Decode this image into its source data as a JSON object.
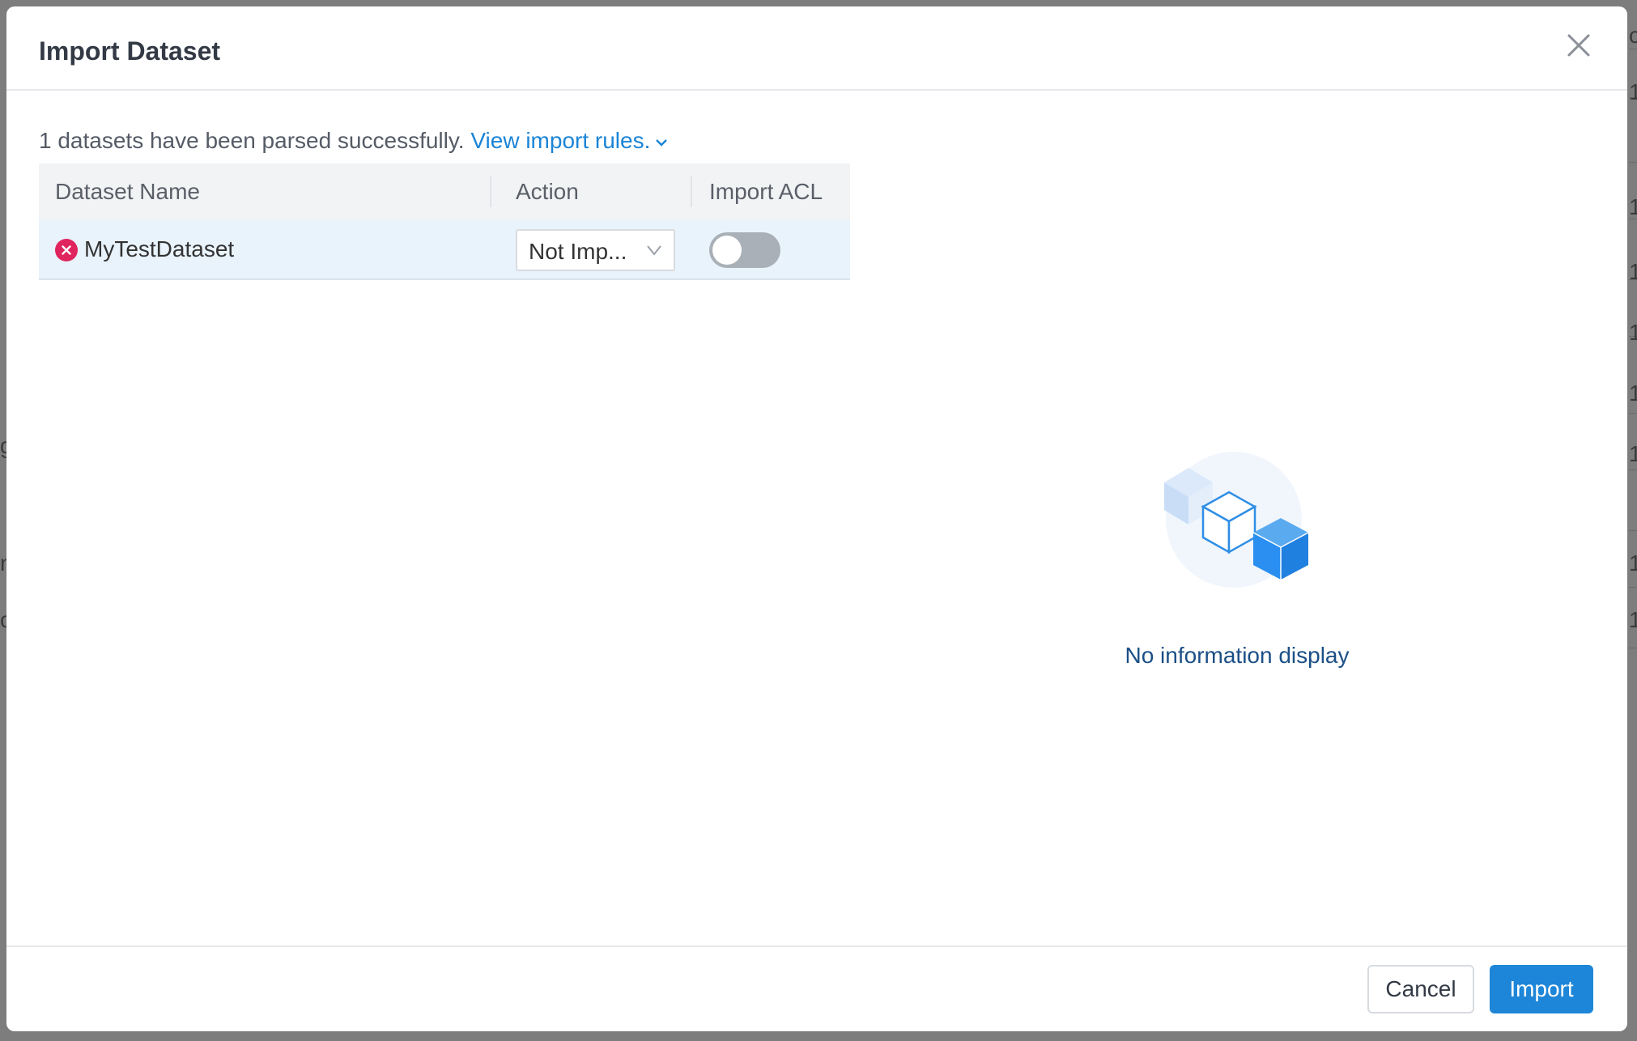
{
  "dialog": {
    "title": "Import Dataset",
    "summary_text": "1 datasets have been parsed successfully.",
    "rules_link": "View import rules."
  },
  "table": {
    "headers": [
      "Dataset Name",
      "Action",
      "Import ACL"
    ],
    "rows": [
      {
        "name": "MyTestDataset",
        "status": "error",
        "action": "Not Imp...",
        "import_acl": false
      }
    ]
  },
  "empty_state": {
    "text": "No information display"
  },
  "footer": {
    "cancel_label": "Cancel",
    "import_label": "Import"
  },
  "background": {
    "edge_glyphs": [
      "c",
      "1",
      "1",
      "1",
      "1",
      "1",
      "g",
      "1",
      "n",
      "1",
      "o",
      "1"
    ]
  },
  "colors": {
    "primary": "#1e86d8",
    "link": "#1b84d6",
    "error": "#e0245e",
    "row_highlight": "#e9f3fc",
    "toggle_off": "#a9b0b7"
  },
  "icons": {
    "close": "close-icon",
    "row_status": "error-circle-icon",
    "select_arrow": "chevron-down-icon",
    "rules_toggle": "chevron-down-icon",
    "empty": "empty-cubes-illustration"
  }
}
